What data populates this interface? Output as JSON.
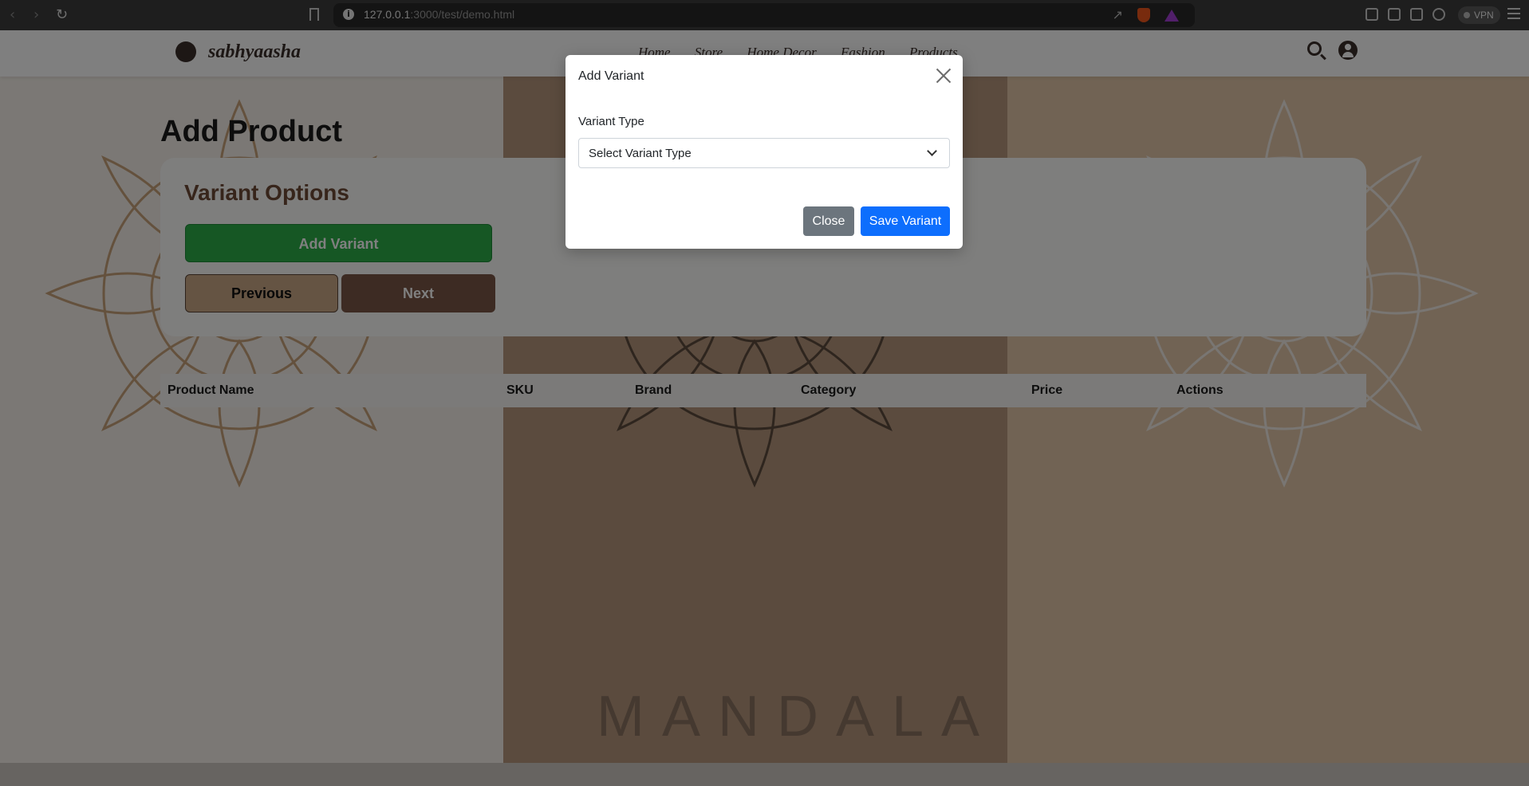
{
  "browser": {
    "url_host": "127.0.0.1",
    "url_rest": ":3000/test/demo.html",
    "vpn_label": "VPN"
  },
  "site": {
    "brand": "sabhyaasha",
    "nav": [
      "Home",
      "Store",
      "Home Decor",
      "Fashion",
      "Products"
    ],
    "background_word": "MANDALA"
  },
  "page": {
    "title": "Add Product",
    "card_title": "Variant Options",
    "add_variant_label": "Add Variant",
    "previous_label": "Previous",
    "next_label": "Next"
  },
  "table": {
    "columns": [
      "Product Name",
      "SKU",
      "Brand",
      "Category",
      "Price",
      "Actions"
    ]
  },
  "modal": {
    "title": "Add Variant",
    "field_label": "Variant Type",
    "select_value": "Select Variant Type",
    "close_label": "Close",
    "save_label": "Save Variant"
  },
  "colors": {
    "primary": "#0d6efd",
    "secondary": "#6c757d",
    "success": "#2cae49",
    "brown": "#7a5746"
  }
}
